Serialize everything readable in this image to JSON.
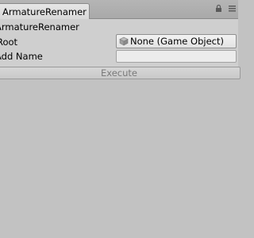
{
  "tab": {
    "title": "ArmatureRenamer"
  },
  "panel": {
    "title": "ArmatureRenamer"
  },
  "fields": {
    "root_label": "Root",
    "root_value": "None (Game Object)",
    "add_name_label": "Add Name",
    "add_name_value": ""
  },
  "actions": {
    "execute_label": "Execute"
  },
  "icons": {
    "object_field_icon": "cube-icon",
    "menu_icons": [
      "lock-icon",
      "context-menu-icon"
    ]
  }
}
